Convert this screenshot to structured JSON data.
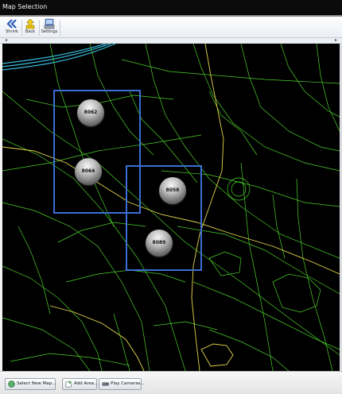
{
  "window": {
    "title": "Map Selection"
  },
  "toolbar": {
    "shrink_label": "Shrink",
    "back_label": "Back",
    "settings_label": "Settings"
  },
  "map": {
    "background": "#000000",
    "road_color": "#4ccf2a",
    "main_road_color": "#e6d64a",
    "water_color": "#38b7d8",
    "area_border_color": "#3b6fd6",
    "cameras": [
      {
        "id": "8062"
      },
      {
        "id": "8064"
      },
      {
        "id": "8058"
      },
      {
        "id": "8089"
      }
    ]
  },
  "bottom": {
    "select_map_label": "Select New Map...",
    "add_area_label": "Add Area...",
    "play_cameras_label": "Play Cameras..."
  }
}
